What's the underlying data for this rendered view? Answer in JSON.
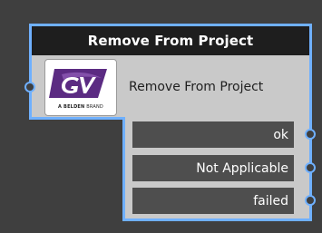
{
  "node": {
    "title": "Remove From Project",
    "label": "Remove From Project",
    "logo": {
      "icon": "gv-logo-icon",
      "letters": "GV",
      "caption_strong": "A BELDEN",
      "caption_light": "BRAND"
    },
    "outputs": [
      {
        "label": "ok"
      },
      {
        "label": "Not Applicable"
      },
      {
        "label": "failed"
      }
    ]
  },
  "colors": {
    "canvas": "#3f3f3f",
    "header": "#1e1e1e",
    "body": "#c9c9c9",
    "output_row": "#4e4e4e",
    "outline": "#6fb0ff",
    "logo_purple": "#5b2b82"
  }
}
